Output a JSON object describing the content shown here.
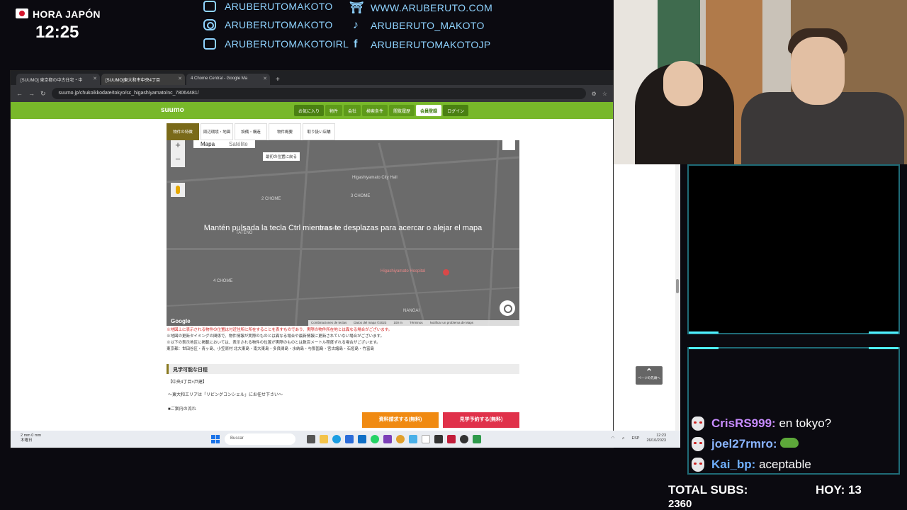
{
  "overlay": {
    "clock_label": "HORA JAPÓN",
    "clock_time": "12:25",
    "socials": [
      {
        "icon": "youtube-icon",
        "text": "ARUBERUTOMAKOTO"
      },
      {
        "icon": "instagram-icon",
        "text": "ARUBERUTOMAKOTO"
      },
      {
        "icon": "youtube-icon",
        "text": "ARUBERUTOMAKOTOIRL"
      },
      {
        "icon": "website-icon",
        "text": "WWW.ARUBERUTO.COM"
      },
      {
        "icon": "tiktok-icon",
        "text": "ARUBERUTO_MAKOTO"
      },
      {
        "icon": "facebook-icon",
        "text": "ARUBERUTOMAKOTOJP"
      }
    ]
  },
  "browser": {
    "tabs": [
      {
        "label": "[SUUMO] 東京都の中古住宅・中",
        "active": false
      },
      {
        "label": "[SUUMO]東大和市中央4丁目",
        "active": true
      },
      {
        "label": "4 Chome Central - Google Ma",
        "active": false
      }
    ],
    "new_tab": "+",
    "url": "suumo.jp/chukoikkodate/tokyo/sc_higashiyamato/nc_78064481/",
    "site": {
      "logo": "suumo",
      "nav": [
        "お気に入り",
        "物件",
        "会社",
        "検索条件",
        "閲覧履歴",
        "会員登録",
        "ログイン"
      ]
    },
    "page_tabs": [
      "物件の特徴",
      "周辺環境・地図",
      "設備・構造",
      "物件概要",
      "取り扱い店舗"
    ],
    "map": {
      "type_map": "Mapa",
      "type_satellite": "Satélite",
      "reset_label": "最初の位置に戻る",
      "zoom_in": "+",
      "zoom_out": "−",
      "ctrl_message": "Mantén pulsada la tecla Ctrl mientras te desplazas para acercar o alejar el mapa",
      "labels": [
        "Higashiyamato City Hall",
        "Higashiyamato Hospital",
        "TATENO",
        "Chuo-Dori",
        "NANGAI",
        "2 CHOME",
        "3 CHOME",
        "4 CHOME"
      ],
      "footer": [
        "Combinaciones de teclas",
        "Datos del mapa ©2023",
        "100 m",
        "Términos",
        "Notificar un problema de Maps"
      ],
      "google": "Google"
    },
    "notes": [
      "※地図上に表示される物件の位置は付近住所に所在することを表すものであり、実際の物件所在地とは異なる場合がございます。",
      "※地図の更新タイミングの関係で、物件情報が実際のものとは異なる場合や最新情報に更新されていない場合がございます。",
      "※以下の表示地区に掲載においては、表示される物件の位置が実際のものとは数百メートル程度ずれる場合がございます。",
      "東京都：世田谷区・青ヶ島、小笠原村 北大東島・南大東島・多良間島・水納島・与那国島・宮古諸島・石垣島・竹富島"
    ],
    "section_title": "見学可能な日程",
    "body_lines": [
      "【中央4丁目×戸建】",
      "〜東大和エリアは「リビングコンシェル」にお任せ下さい〜",
      "■ご案内の流れ"
    ],
    "cta_request": "資料請求する(無料)",
    "cta_visit": "見学予約する(無料)",
    "back_to_top": "ページの先頭へ"
  },
  "taskbar": {
    "weather_temp": "2 mm 0 mm",
    "weather_day": "木曜日",
    "search_placeholder": "Buscar",
    "lang": "ESP",
    "time": "12:23",
    "date": "26/10/2023"
  },
  "chat": [
    {
      "user": "CrisRS999:",
      "message": "en tokyo?",
      "color": "#c88cff"
    },
    {
      "user": "joel27rmro:",
      "message": "",
      "color": "#8ab4ff",
      "emote": true
    },
    {
      "user": "Kai_bp:",
      "message": "aceptable",
      "color": "#6fb0ff"
    }
  ],
  "stats": {
    "total_subs_label": "TOTAL SUBS:",
    "total_subs_value": "2360",
    "today_label": "HOY: 13"
  }
}
